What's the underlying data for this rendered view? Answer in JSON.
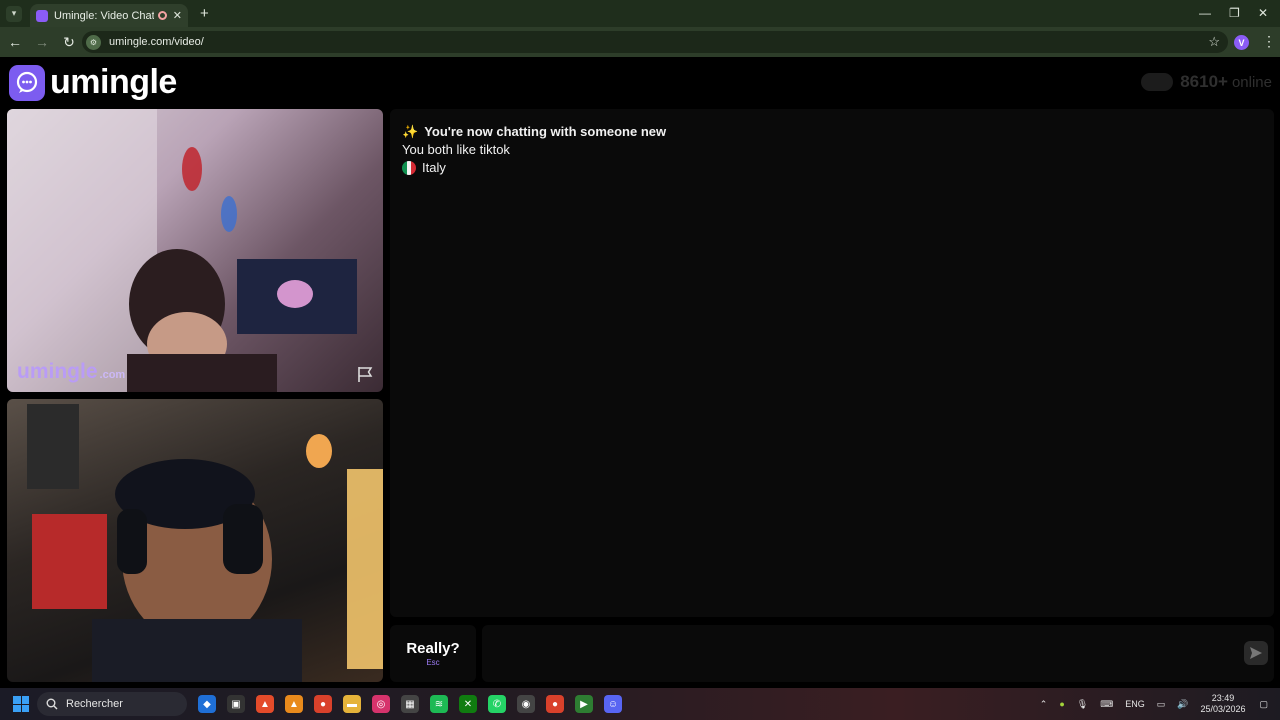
{
  "browser": {
    "tab_title": "Umingle: Video Chat with S",
    "url": "umingle.com/video/",
    "profile_initial": "V"
  },
  "site": {
    "logo_text": "umingle",
    "online_count": "8610+",
    "online_label": "online"
  },
  "video": {
    "watermark_main": "umingle",
    "watermark_sub": ".com"
  },
  "chat": {
    "messages": [
      "You're now chatting with someone new",
      "You both like tiktok",
      "Italy"
    ]
  },
  "controls": {
    "stop_label": "Really?",
    "stop_key": "Esc",
    "input_placeholder": ""
  },
  "taskbar": {
    "search_label": "Rechercher",
    "lang": "ENG",
    "time": "23:49",
    "date": "25/03/2026"
  },
  "colors": {
    "brand": "#7c5cf0",
    "chat_bg": "#0a0a0a"
  }
}
